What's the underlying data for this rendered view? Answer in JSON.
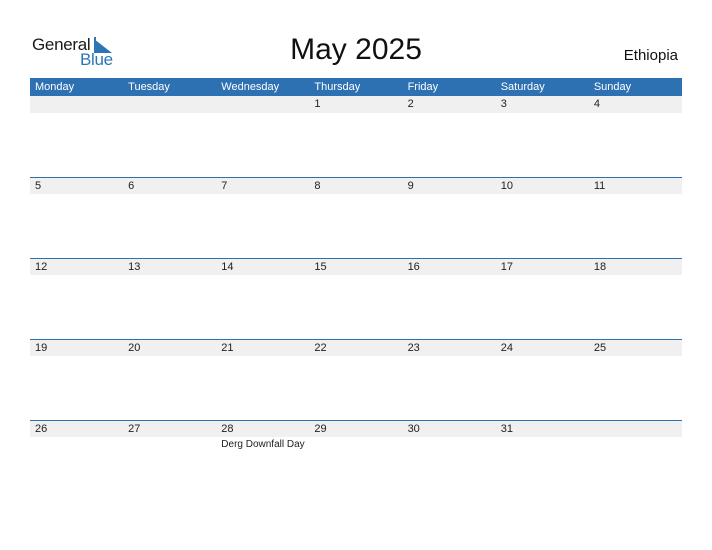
{
  "logo": {
    "general": "General",
    "blue": "Blue",
    "icon": "triangle-flag-icon",
    "brand_color": "#2e75b6"
  },
  "title": "May 2025",
  "country": "Ethiopia",
  "header_color": "#2e71b2",
  "days": [
    "Monday",
    "Tuesday",
    "Wednesday",
    "Thursday",
    "Friday",
    "Saturday",
    "Sunday"
  ],
  "weeks": [
    {
      "dates": [
        "",
        "",
        "",
        "1",
        "2",
        "3",
        "4"
      ],
      "events": [
        "",
        "",
        "",
        "",
        "",
        "",
        ""
      ]
    },
    {
      "dates": [
        "5",
        "6",
        "7",
        "8",
        "9",
        "10",
        "11"
      ],
      "events": [
        "",
        "",
        "",
        "",
        "",
        "",
        ""
      ]
    },
    {
      "dates": [
        "12",
        "13",
        "14",
        "15",
        "16",
        "17",
        "18"
      ],
      "events": [
        "",
        "",
        "",
        "",
        "",
        "",
        ""
      ]
    },
    {
      "dates": [
        "19",
        "20",
        "21",
        "22",
        "23",
        "24",
        "25"
      ],
      "events": [
        "",
        "",
        "",
        "",
        "",
        "",
        ""
      ]
    },
    {
      "dates": [
        "26",
        "27",
        "28",
        "29",
        "30",
        "31",
        ""
      ],
      "events": [
        "",
        "",
        "Derg Downfall Day",
        "",
        "",
        "",
        ""
      ]
    }
  ]
}
